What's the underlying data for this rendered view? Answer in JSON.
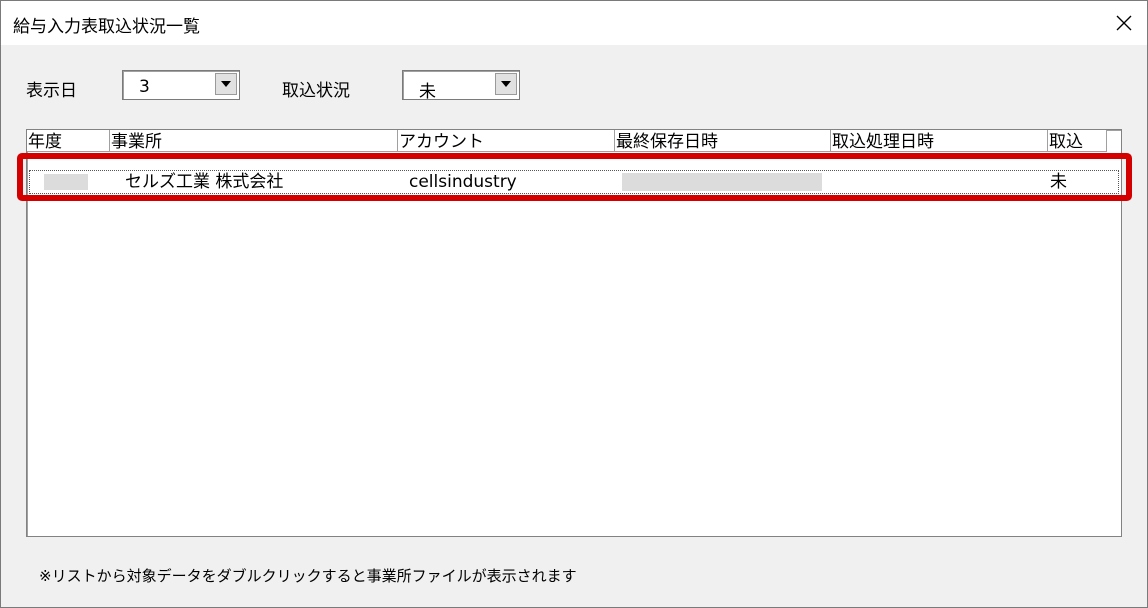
{
  "window": {
    "title": "給与入力表取込状況一覧",
    "close_icon": "close-icon"
  },
  "filters": {
    "display_day_label": "表示日",
    "display_day_value": "3",
    "import_status_label": "取込状況",
    "import_status_value": "未"
  },
  "list": {
    "columns": [
      "年度",
      "事業所",
      "アカウント",
      "最終保存日時",
      "取込処理日時",
      "取込"
    ],
    "rows": [
      {
        "year": "",
        "office": "セルズ工業 株式会社",
        "account": "cellsindustry",
        "last_saved": "",
        "import_processed": "",
        "imported": "未"
      }
    ]
  },
  "footer": {
    "note": "※リストから対象データをダブルクリックすると事業所ファイルが表示されます"
  },
  "colors": {
    "highlight": "#d40000",
    "dialog_bg": "#f0f0f0"
  }
}
